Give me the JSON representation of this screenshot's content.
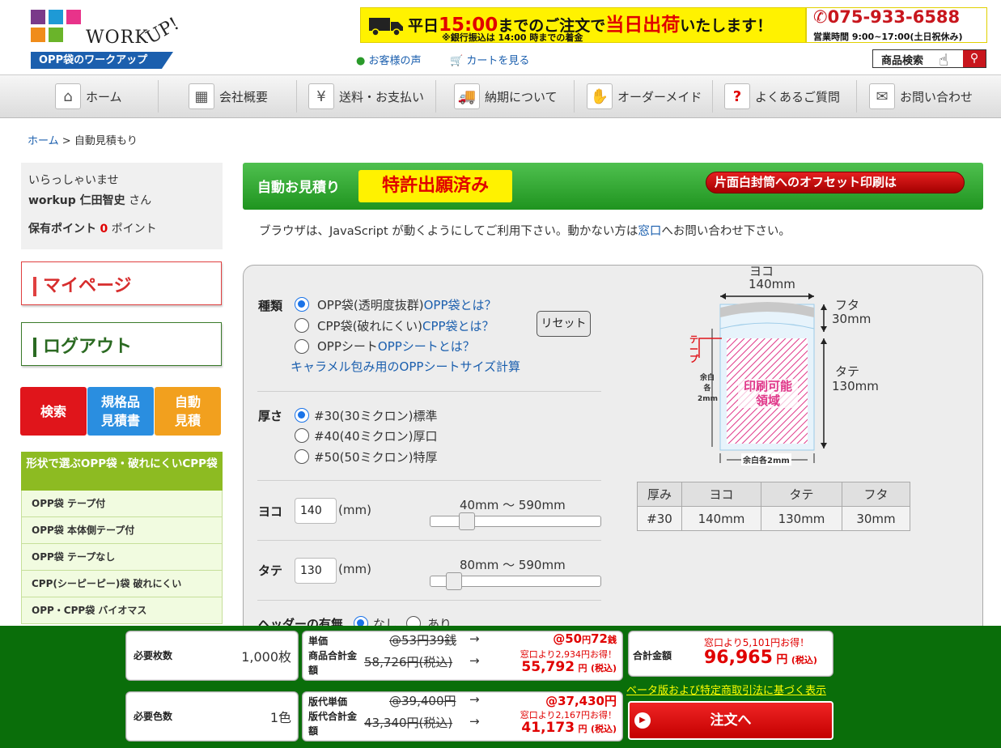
{
  "header": {
    "logo_text": "WORK",
    "logo_up": "UP!",
    "logo_sub": "OPP袋のワークアップ",
    "banner_prefix": "平日",
    "banner_time": "15:00",
    "banner_mid": "までのご注文で",
    "banner_sameday": "当日出荷",
    "banner_suffix": "いたします！",
    "banner_note": "※銀行振込は 14:00 時までの着金",
    "phone": "075-933-6588",
    "hours": "営業時間 9:00~17:00(土日祝休み)",
    "voice_link": "お客様の声",
    "cart_link": "カートを見る",
    "product_search": "商品検索"
  },
  "nav": [
    {
      "label": "ホーム",
      "icon": "home-icon"
    },
    {
      "label": "会社概要",
      "icon": "building-icon"
    },
    {
      "label": "送料・お支払い",
      "icon": "yen-icon"
    },
    {
      "label": "納期について",
      "icon": "truck-icon"
    },
    {
      "label": "オーダーメイド",
      "icon": "hand-icon"
    },
    {
      "label": "よくあるご質問",
      "icon": "question-icon"
    },
    {
      "label": "お問い合わせ",
      "icon": "mail-icon"
    }
  ],
  "breadcrumb": {
    "home": "ホーム",
    "sep": ">",
    "current": "自動見積もり"
  },
  "sidebar": {
    "greeting": "いらっしゃいませ",
    "user_name": "workup 仁田智史",
    "user_suffix": "さん",
    "points_label": "保有ポイント",
    "points_value": "0",
    "points_unit": "ポイント",
    "mypage": "マイページ",
    "logout": "ログアウト",
    "search": "検索",
    "standard_quote_1": "規格品",
    "standard_quote_2": "見積書",
    "auto_quote_1": "自動",
    "auto_quote_2": "見積",
    "category_header": "形状で選ぶOPP袋・破れにくいCPP袋",
    "categories": [
      "OPP袋 テープ付",
      "OPP袋 本体側テープ付",
      "OPP袋 テープなし",
      "CPP(シーピーピー)袋 破れにくい",
      "OPP・CPP袋 バイオマス"
    ]
  },
  "main": {
    "title": "自動お見積り",
    "patent": "特許出願済み",
    "offset_banner": "片面白封筒へのオフセット印刷は",
    "js_note_pre": "ブラウザは、JavaScript が動くようにしてご利用下さい。動かない方は",
    "js_note_link": "窓口",
    "js_note_post": "へお問い合わせ下さい。"
  },
  "form": {
    "type_label": "種類",
    "type_options": [
      {
        "text": "OPP袋(透明度抜群)",
        "link": "OPP袋とは？",
        "selected": true
      },
      {
        "text": "CPP袋(破れにくい)",
        "link": "CPP袋とは？",
        "selected": false
      },
      {
        "text": "OPPシート",
        "link": "OPPシートとは？",
        "selected": false
      }
    ],
    "caramel_link": "キャラメル包み用のOPPシートサイズ計算",
    "reset": "リセット",
    "thickness_label": "厚さ",
    "thickness_options": [
      "#30(30ミクロン)標準",
      "#40(40ミクロン)厚口",
      "#50(50ミクロン)特厚"
    ],
    "width_label": "ヨコ",
    "width_value": "140",
    "width_unit": "(mm)",
    "width_range": "40mm 〜 590mm",
    "width_slider": {
      "min": 40,
      "max": 590,
      "value": 140
    },
    "height_label": "タテ",
    "height_value": "130",
    "height_unit": "(mm)",
    "height_range": "80mm 〜 590mm",
    "height_slider": {
      "min": 80,
      "max": 590,
      "value": 130
    },
    "header_label": "ヘッダーの有無",
    "header_none": "なし",
    "header_yes": "あり"
  },
  "diagram": {
    "width_label": "ヨコ",
    "width_value": "140mm",
    "flap_label": "フタ",
    "flap_value": "30mm",
    "height_label": "タテ",
    "height_value": "130mm",
    "tape": "テープ",
    "margin_side_1": "余白",
    "margin_side_2": "各",
    "margin_side_3": "2mm",
    "printable_1": "印刷可能",
    "printable_2": "領域",
    "margin_bottom": "余白各2mm"
  },
  "spec_table": {
    "headers": [
      "厚み",
      "ヨコ",
      "タテ",
      "フタ"
    ],
    "row": [
      "#30",
      "140mm",
      "130mm",
      "30mm"
    ]
  },
  "bottom": {
    "qty_label": "必要枚数",
    "qty_value": "1,000枚",
    "colors_label": "必要色数",
    "colors_value": "1色",
    "unit_price_label": "単価",
    "product_total_label_1": "商品合計金",
    "product_total_label_2": "額",
    "unit_old": "@53円39銭",
    "unit_new_yen": "@50",
    "unit_new_yen_unit": "円",
    "unit_new_sen": "72",
    "unit_new_sen_unit": "銭",
    "arrow": "→",
    "product_old": "58,726円(税込)",
    "product_savings": "窓口より2,934円お得！",
    "product_new": "55,792",
    "yen_tax": "円",
    "tax": "(税込)",
    "plate_unit_label": "版代単価",
    "plate_total_label_1": "版代合計金",
    "plate_total_label_2": "額",
    "plate_old": "@39,400円",
    "plate_new": "@37,430円",
    "plate_total_old": "43,340円(税込)",
    "plate_savings": "窓口より2,167円お得！",
    "plate_total_new": "41,173",
    "grand_label": "合計金額",
    "grand_savings": "窓口より5,101円お得！",
    "grand_value": "96,965",
    "beta_link": "ベータ版および特定商取引法に基づく表示",
    "order": "注文へ"
  }
}
